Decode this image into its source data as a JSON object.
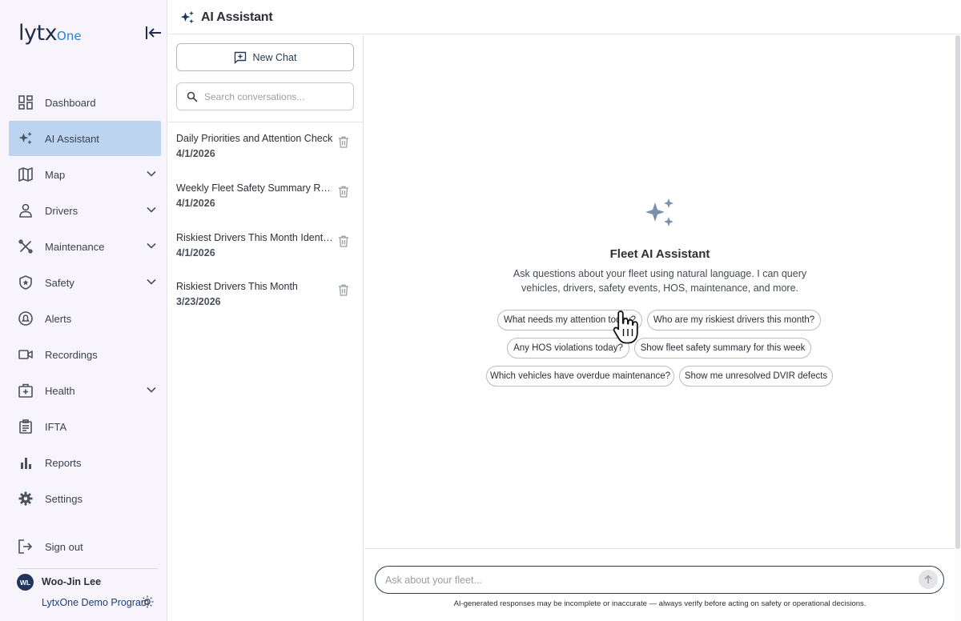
{
  "app": {
    "logo_main": "lytx",
    "logo_accent": "One"
  },
  "colors": {
    "accent": "#1f3560",
    "active_nav_bg": "#bcd4ef",
    "spark": "#7b90ad"
  },
  "sidebar": {
    "items": [
      {
        "label": "Dashboard",
        "icon": "dashboard-icon",
        "active": false,
        "has_children": false
      },
      {
        "label": "AI Assistant",
        "icon": "sparkle-icon",
        "active": true,
        "has_children": false
      },
      {
        "label": "Map",
        "icon": "map-icon",
        "active": false,
        "has_children": true
      },
      {
        "label": "Drivers",
        "icon": "person-icon",
        "active": false,
        "has_children": true
      },
      {
        "label": "Maintenance",
        "icon": "wrench-icon",
        "active": false,
        "has_children": true
      },
      {
        "label": "Safety",
        "icon": "shield-star-icon",
        "active": false,
        "has_children": true
      },
      {
        "label": "Alerts",
        "icon": "alert-bell-icon",
        "active": false,
        "has_children": false
      },
      {
        "label": "Recordings",
        "icon": "video-camera-icon",
        "active": false,
        "has_children": false
      },
      {
        "label": "Health",
        "icon": "medical-kit-icon",
        "active": false,
        "has_children": true
      },
      {
        "label": "IFTA",
        "icon": "clipboard-icon",
        "active": false,
        "has_children": false
      },
      {
        "label": "Reports",
        "icon": "bar-chart-icon",
        "active": false,
        "has_children": false
      },
      {
        "label": "Settings",
        "icon": "gear-icon",
        "active": false,
        "has_children": false
      }
    ],
    "signout_label": "Sign out",
    "user": {
      "initials": "WL",
      "name": "Woo-Jin Lee",
      "program": "LytxOne Demo Program"
    }
  },
  "header": {
    "title": "AI Assistant"
  },
  "conversations": {
    "new_chat_label": "New Chat",
    "search_placeholder": "Search conversations...",
    "items": [
      {
        "title": "Daily Priorities and Attention Check",
        "date": "4/1/2026"
      },
      {
        "title": "Weekly Fleet Safety Summary Report",
        "date": "4/1/2026"
      },
      {
        "title": "Riskiest Drivers This Month Identified",
        "date": "4/1/2026"
      },
      {
        "title": "Riskiest Drivers This Month",
        "date": "3/23/2026"
      }
    ]
  },
  "main": {
    "title": "Fleet AI Assistant",
    "description": "Ask questions about your fleet using natural language. I can query vehicles, drivers, safety events, HOS, maintenance, and more.",
    "suggestions": [
      "What needs my attention today?",
      "Who are my riskiest drivers this month?",
      "Any HOS violations today?",
      "Show fleet safety summary for this week",
      "Which vehicles have overdue maintenance?",
      "Show me unresolved DVIR defects"
    ],
    "input_placeholder": "Ask about your fleet...",
    "disclaimer": "AI-generated responses may be incomplete or inaccurate — always verify before acting on safety or operational decisions."
  }
}
